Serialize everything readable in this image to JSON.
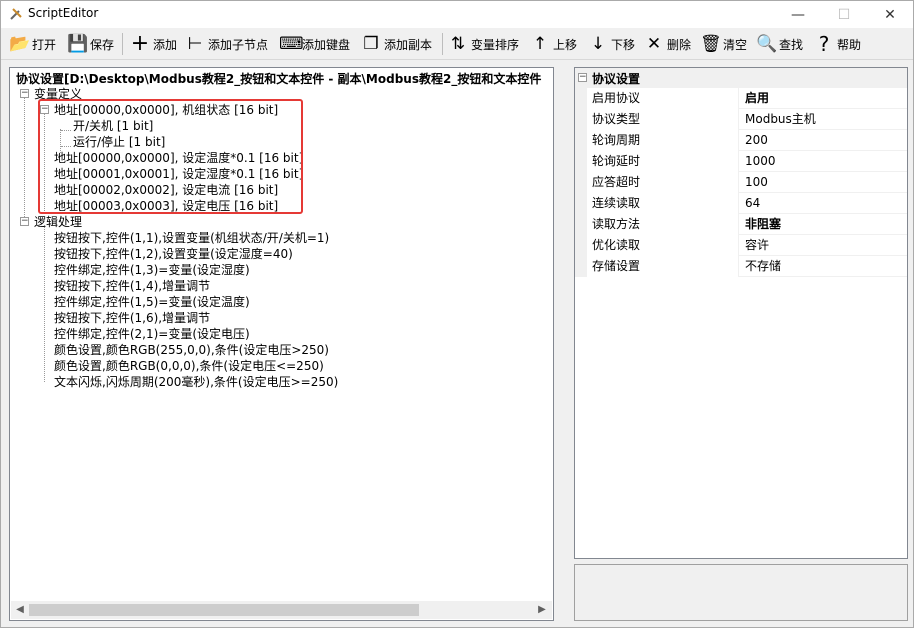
{
  "window": {
    "title": "ScriptEditor",
    "controls": {
      "minimize": "—",
      "maximize": "☐",
      "close": "✕"
    }
  },
  "toolbar": [
    {
      "id": "open",
      "label": "打开",
      "icon": "folder-open-icon",
      "glyph": "📂"
    },
    {
      "id": "save",
      "label": "保存",
      "icon": "save-icon",
      "glyph": "💾"
    },
    {
      "id": "add",
      "label": "添加",
      "icon": "plus-icon",
      "glyph": "+"
    },
    {
      "id": "add-child",
      "label": "添加子节点",
      "icon": "add-child-icon",
      "glyph": "⊢"
    },
    {
      "id": "add-keyboard",
      "label": "添加键盘",
      "icon": "keyboard-icon",
      "glyph": "⌨"
    },
    {
      "id": "add-copy",
      "label": "添加副本",
      "icon": "copy-icon",
      "glyph": "❐"
    },
    {
      "id": "sort-vars",
      "label": "变量排序",
      "icon": "sort-icon",
      "glyph": "⇅"
    },
    {
      "id": "move-up",
      "label": "上移",
      "icon": "arrow-up-icon",
      "glyph": "↑"
    },
    {
      "id": "move-down",
      "label": "下移",
      "icon": "arrow-down-icon",
      "glyph": "↓"
    },
    {
      "id": "delete",
      "label": "删除",
      "icon": "x-icon",
      "glyph": "✕"
    },
    {
      "id": "clear",
      "label": "清空",
      "icon": "trash-icon",
      "glyph": "🗑"
    },
    {
      "id": "find",
      "label": "查找",
      "icon": "search-icon",
      "glyph": "🔍"
    },
    {
      "id": "help",
      "label": "帮助",
      "icon": "help-icon",
      "glyph": "?"
    }
  ],
  "tree": {
    "root": "协议设置[D:\\Desktop\\Modbus教程2_按钮和文本控件 - 副本\\Modbus教程2_按钮和文本控件",
    "var_section": "变量定义",
    "var_items": [
      {
        "label": "地址[00000,0x0000], 机组状态 [16 bit]",
        "children": [
          "开/关机 [1 bit]",
          "运行/停止 [1 bit]"
        ]
      },
      {
        "label": "地址[00000,0x0000], 设定温度*0.1 [16 bit]"
      },
      {
        "label": "地址[00001,0x0001], 设定湿度*0.1 [16 bit]"
      },
      {
        "label": "地址[00002,0x0002], 设定电流 [16 bit]"
      },
      {
        "label": "地址[00003,0x0003], 设定电压 [16 bit]"
      }
    ],
    "logic_section": "逻辑处理",
    "logic_items": [
      "按钮按下,控件(1,1),设置变量(机组状态/开/关机=1)",
      "按钮按下,控件(1,2),设置变量(设定湿度=40)",
      "控件绑定,控件(1,3)=变量(设定湿度)",
      "按钮按下,控件(1,4),增量调节",
      "控件绑定,控件(1,5)=变量(设定温度)",
      "按钮按下,控件(1,6),增量调节",
      "控件绑定,控件(2,1)=变量(设定电压)",
      "颜色设置,颜色RGB(255,0,0),条件(设定电压>250)",
      "颜色设置,颜色RGB(0,0,0),条件(设定电压<=250)",
      "文本闪烁,闪烁周期(200毫秒),条件(设定电压>=250)"
    ]
  },
  "properties": {
    "category": "协议设置",
    "rows": [
      {
        "key": "启用协议",
        "value": "启用",
        "bold": true
      },
      {
        "key": "协议类型",
        "value": "Modbus主机",
        "bold": false
      },
      {
        "key": "轮询周期",
        "value": "200",
        "bold": false
      },
      {
        "key": "轮询延时",
        "value": "1000",
        "bold": false
      },
      {
        "key": "应答超时",
        "value": "100",
        "bold": false
      },
      {
        "key": "连续读取",
        "value": "64",
        "bold": false
      },
      {
        "key": "读取方法",
        "value": "非阻塞",
        "bold": true
      },
      {
        "key": "优化读取",
        "value": "容许",
        "bold": false
      },
      {
        "key": "存储设置",
        "value": "不存储",
        "bold": false
      }
    ]
  },
  "colors": {
    "highlight_border": "#e53935",
    "panel_border": "#828790"
  }
}
